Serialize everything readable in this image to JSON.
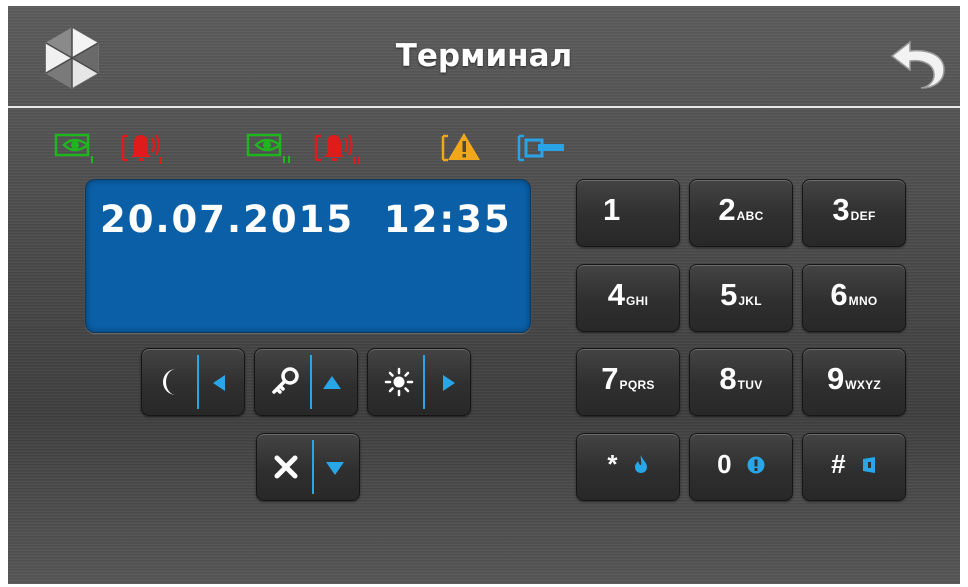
{
  "header": {
    "title": "Терминал",
    "logo_icon": "satel-cube-logo-icon",
    "back_icon": "undo-back-arrow-icon"
  },
  "status_icons": [
    {
      "name": "partition-1-armed-eye-icon",
      "color": "#1fb51f",
      "subscript": "I"
    },
    {
      "name": "partition-1-alarm-bell-icon",
      "color": "#e01b1b",
      "subscript": "I"
    },
    {
      "name": "partition-2-armed-eye-icon",
      "color": "#1fb51f",
      "subscript": "II"
    },
    {
      "name": "partition-2-alarm-bell-icon",
      "color": "#e01b1b",
      "subscript": "II"
    },
    {
      "name": "trouble-warning-icon",
      "color": "#f0a81a",
      "subscript": ""
    },
    {
      "name": "service-mode-icon",
      "color": "#2aa3e6",
      "subscript": ""
    }
  ],
  "display": {
    "line1": "20.07.2015  12:35",
    "line2": ""
  },
  "keypad": [
    {
      "digit": "1",
      "sub": ""
    },
    {
      "digit": "2",
      "sub": "ABC"
    },
    {
      "digit": "3",
      "sub": "DEF"
    },
    {
      "digit": "4",
      "sub": "GHI"
    },
    {
      "digit": "5",
      "sub": "JKL"
    },
    {
      "digit": "6",
      "sub": "MNO"
    },
    {
      "digit": "7",
      "sub": "PQRS"
    },
    {
      "digit": "8",
      "sub": "TUV"
    },
    {
      "digit": "9",
      "sub": "WXYZ"
    },
    {
      "digit": "*",
      "sub": "",
      "icon": "fire-icon"
    },
    {
      "digit": "0",
      "sub": "",
      "icon": "info-exclamation-icon"
    },
    {
      "digit": "#",
      "sub": "",
      "icon": "medical-icon"
    }
  ],
  "nav_keys": [
    {
      "name": "night-left-key",
      "left_icon": "moon-icon",
      "right_icon": "arrow-left-icon"
    },
    {
      "name": "key-up-key",
      "left_icon": "key-icon",
      "right_icon": "arrow-up-icon"
    },
    {
      "name": "day-right-key",
      "left_icon": "sun-icon",
      "right_icon": "arrow-right-icon"
    },
    {
      "name": "cancel-down-key",
      "left_icon": "x-cancel-icon",
      "right_icon": "arrow-down-icon"
    }
  ],
  "colors": {
    "accent_blue": "#29a6e8",
    "lcd_background": "#0a5fa6",
    "armed_green": "#1fb51f",
    "alarm_red": "#e01b1b",
    "trouble_orange": "#f0a81a",
    "service_blue": "#2aa3e6"
  }
}
